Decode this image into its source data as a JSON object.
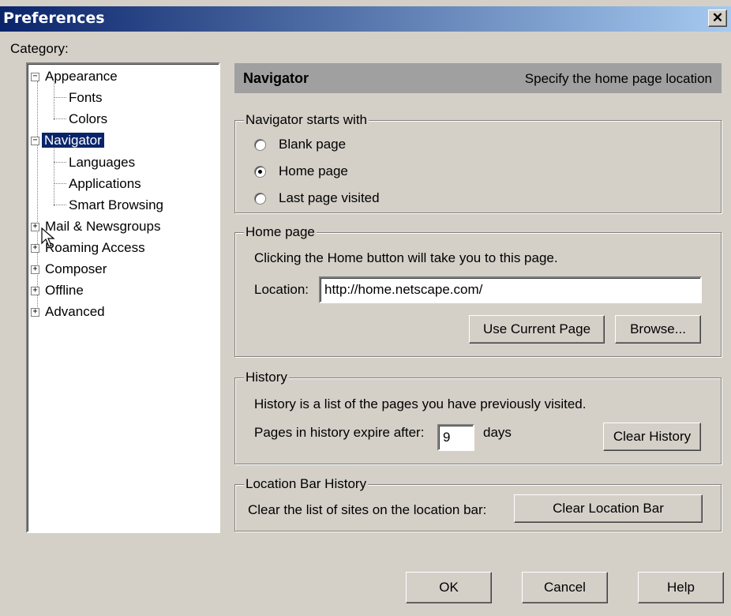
{
  "window": {
    "title": "Preferences"
  },
  "category_label": "Category:",
  "tree": {
    "appearance": "Appearance",
    "fonts": "Fonts",
    "colors": "Colors",
    "navigator": "Navigator",
    "languages": "Languages",
    "applications": "Applications",
    "smart_browsing": "Smart Browsing",
    "mail": "Mail & Newsgroups",
    "roaming": "Roaming Access",
    "composer": "Composer",
    "offline": "Offline",
    "advanced": "Advanced"
  },
  "panel": {
    "title": "Navigator",
    "subtitle": "Specify the home page location"
  },
  "starts_with": {
    "legend": "Navigator starts with",
    "options": [
      "Blank page",
      "Home page",
      "Last page visited"
    ],
    "selected": "Home page"
  },
  "home_page": {
    "legend": "Home page",
    "description": "Clicking the Home button will take you to this page.",
    "location_label": "Location:",
    "location_value": "http://home.netscape.com/",
    "use_current": "Use Current Page",
    "browse": "Browse..."
  },
  "history": {
    "legend": "History",
    "description": "History is a list of the pages you have previously visited.",
    "expire_label": "Pages in history expire after:",
    "days_value": "9",
    "days_label": "days",
    "clear": "Clear History"
  },
  "location_bar": {
    "legend": "Location Bar History",
    "description": "Clear the list of sites on the location bar:",
    "clear": "Clear Location Bar"
  },
  "footer": {
    "ok": "OK",
    "cancel": "Cancel",
    "help": "Help"
  },
  "colors": {
    "titlebar_start": "#0a246a",
    "titlebar_end": "#a6caf0",
    "selection": "#0a246a",
    "dialog_bg": "#d4d0c8",
    "header_bg": "#a0a0a0"
  }
}
